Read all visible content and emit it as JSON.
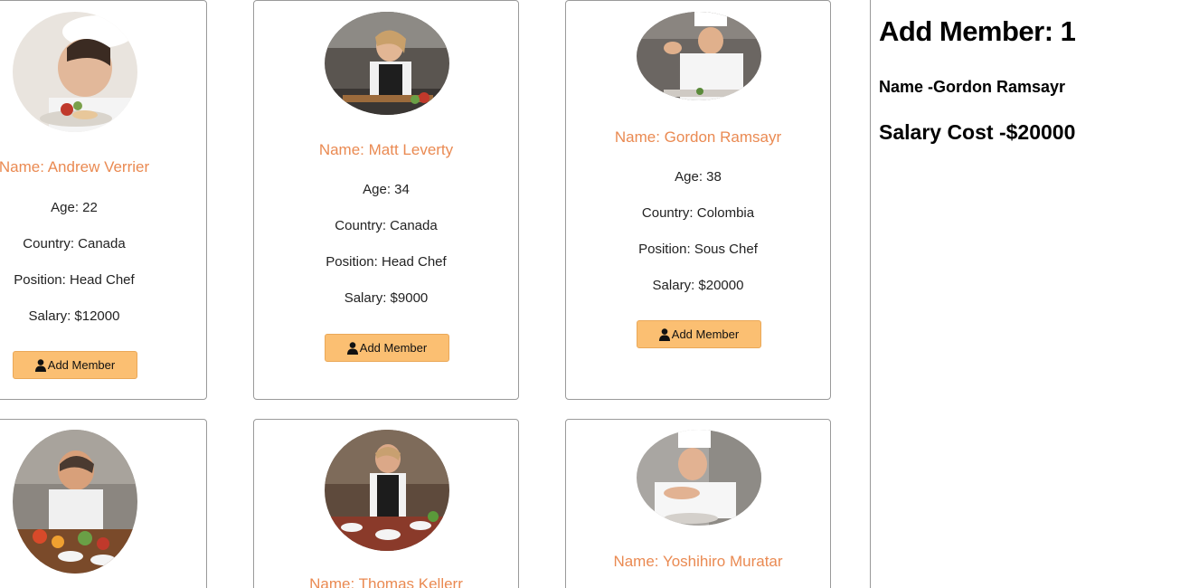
{
  "members": [
    {
      "name": "Name: Andrew Verrier",
      "age": "Age: 22",
      "country": "Country: Canada",
      "position": "Position: Head Chef",
      "salary": "Salary: $12000",
      "button": "Add Member",
      "photo": "chef-woman-plating"
    },
    {
      "name": "Name: Matt Leverty",
      "age": "Age: 34",
      "country": "Country: Canada",
      "position": "Position: Head Chef",
      "salary": "Salary: $9000",
      "button": "Add Member",
      "photo": "chef-woman-cooking-kitchen"
    },
    {
      "name": "Name: Gordon Ramsayr",
      "age": "Age: 38",
      "country": "Country: Colombia",
      "position": "Position: Sous Chef",
      "salary": "Salary: $20000",
      "button": "Add Member",
      "photo": "chef-man-garnishing"
    },
    {
      "name": "",
      "photo": "chef-man-vegetables"
    },
    {
      "name": "Name: Thomas Kellerr",
      "photo": "chef-man-apron-kitchen"
    },
    {
      "name": "Name: Yoshihiro Muratar",
      "photo": "chef-man-smiling"
    }
  ],
  "summary": {
    "title": "Add Member: 1",
    "name_line": "Name -Gordon Ramsayr",
    "salary_line": "Salary Cost -$20000"
  },
  "colors": {
    "name_text": "#ea8a52",
    "button_bg": "#fbbf72",
    "card_border": "#9a9a9a"
  }
}
